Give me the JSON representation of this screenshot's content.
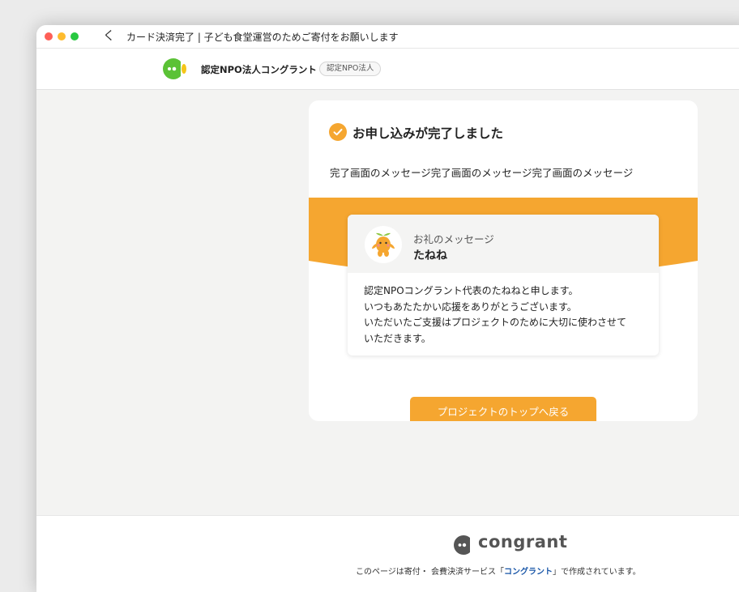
{
  "window": {
    "title": "カード決済完了 | 子ども食堂運営のためご寄付をお願いします",
    "back_glyph": "く"
  },
  "site": {
    "org_name": "認定NPO法人コングラント",
    "org_badge": "認定NPO法人"
  },
  "completion": {
    "title": "お申し込みが完了しました",
    "message": "完了画面のメッセージ完了画面のメッセージ完了画面のメッセージ"
  },
  "thanks": {
    "label": "お礼のメッセージ",
    "name": "たねね",
    "lines": [
      "認定NPOコングラント代表のたねねと申します。",
      "いつもあたたかい応援をありがとうございます。",
      "いただいたご支援はプロジェクトのために大切に使わさせて",
      "いただきます。"
    ]
  },
  "actions": {
    "back_to_project": "プロジェクトのトップへ戻る"
  },
  "footer": {
    "logo_text": "congrant",
    "text_before": "このページは寄付・ 会費決済サービス「",
    "link_text": "コングラント",
    "text_after": "」で作成されています。"
  },
  "colors": {
    "accent_orange": "#f5a630",
    "logo_green": "#5bc236",
    "link_blue": "#1a57a8"
  },
  "icons": {
    "check": "check-circle-icon",
    "org_logo": "congrant-logo-icon",
    "mascot": "tanene-mascot-avatar"
  }
}
